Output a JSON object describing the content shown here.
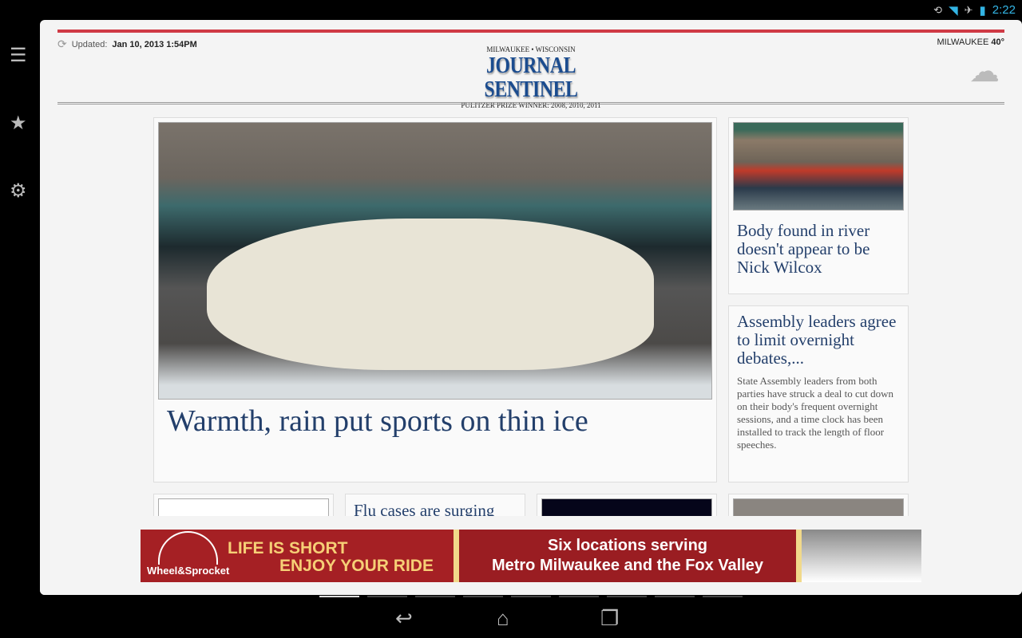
{
  "status": {
    "time": "2:22"
  },
  "header": {
    "updated_label": "Updated:",
    "updated_value": "Jan 10, 2013 1:54PM",
    "masthead_top": "MILWAUKEE • WISCONSIN",
    "masthead": "JOURNAL SENTINEL",
    "masthead_sub": "PULITZER PRIZE WINNER: 2008, 2010, 2011",
    "weather_city": "MILWAUKEE",
    "weather_temp": "40°"
  },
  "stories": {
    "main": {
      "headline": "Warmth, rain put sports on thin ice"
    },
    "side1": {
      "headline": "Body found in river doesn't appear to be Nick Wilcox"
    },
    "side2": {
      "headline": "Assembly leaders agree to limit overnight debates,...",
      "summary": "State Assembly leaders from both parties have struck a deal to cut down on their body's frequent overnight sessions, and a time clock has been installed to track the length of floor speeches."
    },
    "row2": {
      "headline": "Flu cases are surging"
    }
  },
  "ad": {
    "brand": "Wheel&Sprocket",
    "line1": "LIFE IS SHORT",
    "line2": "ENJOY YOUR RIDE",
    "line3": "Six locations serving",
    "line4": "Metro Milwaukee and the Fox Valley"
  }
}
